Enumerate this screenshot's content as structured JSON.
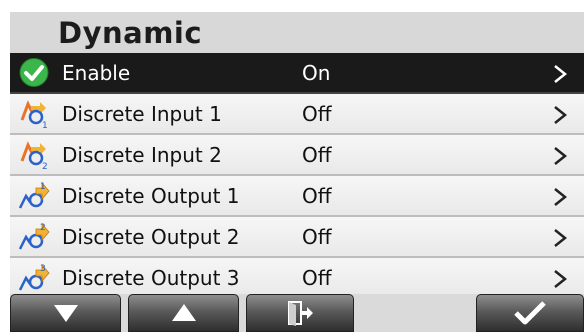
{
  "screen": {
    "title": "Dynamic"
  },
  "rows": [
    {
      "icon": "check-circle-icon",
      "label": "Enable",
      "value": "On",
      "selected": true
    },
    {
      "icon": "discrete-input-icon",
      "label": "Discrete Input 1",
      "value": "Off",
      "subscript": "1"
    },
    {
      "icon": "discrete-input-icon",
      "label": "Discrete Input 2",
      "value": "Off",
      "subscript": "2"
    },
    {
      "icon": "discrete-output-icon",
      "label": "Discrete Output 1",
      "value": "Off",
      "subscript": "1"
    },
    {
      "icon": "discrete-output-icon",
      "label": "Discrete Output 2",
      "value": "Off",
      "subscript": "2"
    },
    {
      "icon": "discrete-output-icon",
      "label": "Discrete Output 3",
      "value": "Off",
      "subscript": "3"
    }
  ],
  "softkeys": [
    {
      "icon": "arrow-down-icon"
    },
    {
      "icon": "arrow-up-icon"
    },
    {
      "icon": "exit-door-icon"
    },
    {
      "icon": "checkmark-icon"
    }
  ],
  "colors": {
    "selected_row": "#1a1a1a",
    "check_green": "#3cb54a",
    "input_icon_orange": "#e8742a",
    "output_icon_blue": "#2a62c9",
    "softkey": "#4a4a4a"
  }
}
